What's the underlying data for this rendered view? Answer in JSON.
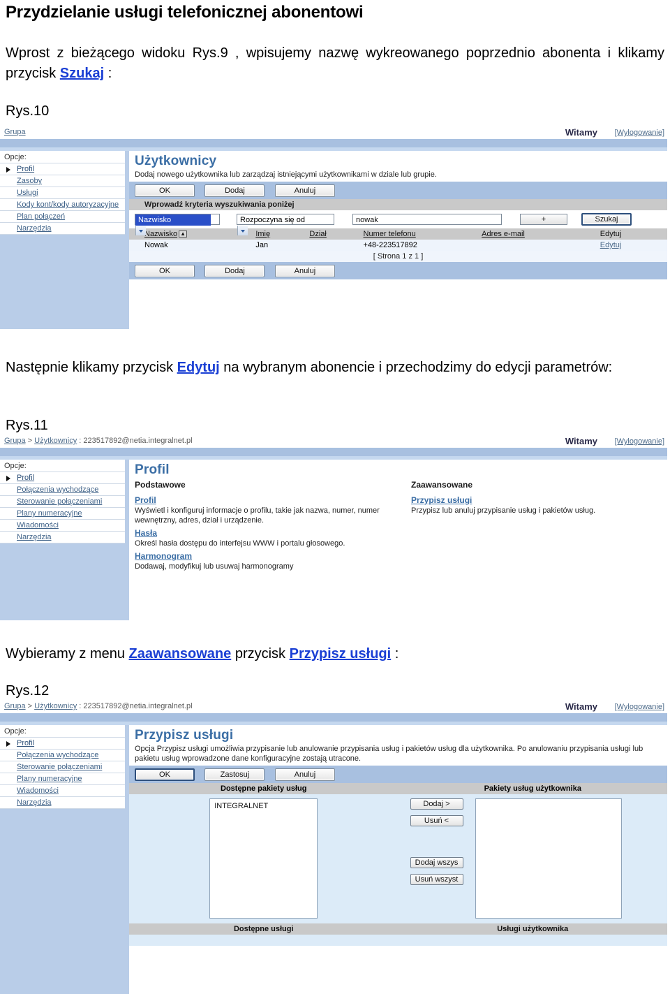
{
  "document": {
    "title": "Przydzielanie usługi telefonicznej abonentowi",
    "para1_a": "Wprost z bieżącego widoku Rys.9 , wpisujemy nazwę wykreowanego poprzednio abonenta i klikamy przycisk ",
    "para1_link": "Szukaj",
    "para1_b": " :",
    "fig10_label": "Rys.10",
    "para2_a": "Następnie klikamy przycisk ",
    "para2_link": "Edytuj",
    "para2_b": " na wybranym abonencie i przechodzimy do edycji parametrów:",
    "fig11_label": "Rys.11",
    "para3_a": "Wybieramy z menu ",
    "para3_link1": "Zaawansowane",
    "para3_mid": " przycisk ",
    "para3_link2": "Przypisz usługi",
    "para3_b": " :",
    "fig12_label": "Rys.12"
  },
  "shot10": {
    "breadcrumb": "Grupa",
    "welcome": "Witamy",
    "logout": "[Wylogowanie]",
    "nav_title": "Opcje:",
    "nav_items": [
      "Profil",
      "Zasoby",
      "Usługi",
      "Kody kont/kody autoryzacyjne",
      "Plan połączeń",
      "Narzędzia"
    ],
    "heading": "Użytkownicy",
    "subtext": "Dodaj nowego użytkownika lub zarządzaj istniejącymi użytkownikami w dziale lub grupie.",
    "buttons_top": [
      "OK",
      "Dodaj",
      "Anuluj"
    ],
    "criteria_bar": "Wprowadź kryteria wyszukiwania poniżej",
    "field_select": "Nazwisko",
    "op_select": "Rozpoczyna się od",
    "search_value": "nowak",
    "plus_button": "+",
    "search_button": "Szukaj",
    "table_headers": [
      "Nazwisko",
      "Imię",
      "Dział",
      "Numer telefonu",
      "Adres e-mail",
      "Edytuj"
    ],
    "sort_marker": "▲",
    "rows": [
      {
        "nazwisko": "Nowak",
        "imie": "Jan",
        "dzial": "",
        "numer": "+48-223517892",
        "email": "",
        "edytuj": "Edytuj"
      }
    ],
    "pager": "[ Strona 1 z 1 ]",
    "buttons_bottom": [
      "OK",
      "Dodaj",
      "Anuluj"
    ]
  },
  "shot11": {
    "breadcrumb_1": "Grupa",
    "breadcrumb_sep": " > ",
    "breadcrumb_2": "Użytkownicy",
    "breadcrumb_3": " : 223517892@netia.integralnet.pl",
    "welcome": "Witamy",
    "logout": "[Wylogowanie]",
    "nav_title": "Opcje:",
    "nav_items": [
      "Profil",
      "Połączenia wychodzące",
      "Sterowanie połączeniami",
      "Plany numeracyjne",
      "Wiadomości",
      "Narzędzia"
    ],
    "heading": "Profil",
    "col_basic_header": "Podstawowe",
    "col_adv_header": "Zaawansowane",
    "basic_entries": [
      {
        "link": "Profil",
        "desc": "Wyświetl i konfiguruj informacje o profilu, takie jak nazwa, numer, numer wewnętrzny, adres, dział i urządzenie."
      },
      {
        "link": "Hasła",
        "desc": "Określ hasła dostępu do interfejsu WWW i portalu głosowego."
      },
      {
        "link": "Harmonogram",
        "desc": "Dodawaj, modyfikuj lub usuwaj harmonogramy"
      }
    ],
    "advanced_entries": [
      {
        "link": "Przypisz usługi",
        "desc": "Przypisz lub anuluj przypisanie usług i pakietów usług."
      }
    ]
  },
  "shot12": {
    "breadcrumb_1": "Grupa",
    "breadcrumb_sep": " > ",
    "breadcrumb_2": "Użytkownicy",
    "breadcrumb_3": " : 223517892@netia.integralnet.pl",
    "welcome": "Witamy",
    "logout": "[Wylogowanie]",
    "nav_title": "Opcje:",
    "nav_items": [
      "Profil",
      "Połączenia wychodzące",
      "Sterowanie połączeniami",
      "Plany numeracyjne",
      "Wiadomości",
      "Narzędzia"
    ],
    "heading": "Przypisz usługi",
    "subtext": "Opcja Przypisz usługi umożliwia przypisanie lub anulowanie przypisania usług i pakietów usług dla użytkownika. Po anulowaniu przypisania usługi lub pakietu usług wprowadzone dane konfiguracyjne zostają utracone.",
    "buttons_top": [
      "OK",
      "Zastosuj",
      "Anuluj"
    ],
    "col_available_header": "Dostępne pakiety usług",
    "col_assigned_header": "Pakiety usług użytkownika",
    "available_items": [
      "INTEGRALNET"
    ],
    "assigned_items": [],
    "transfer_buttons": [
      "Dodaj >",
      "Usuń <",
      "Dodaj wszys",
      "Usuń wszyst"
    ],
    "footer_left": "Dostępne usługi",
    "footer_right": "Usługi użytkownika"
  }
}
